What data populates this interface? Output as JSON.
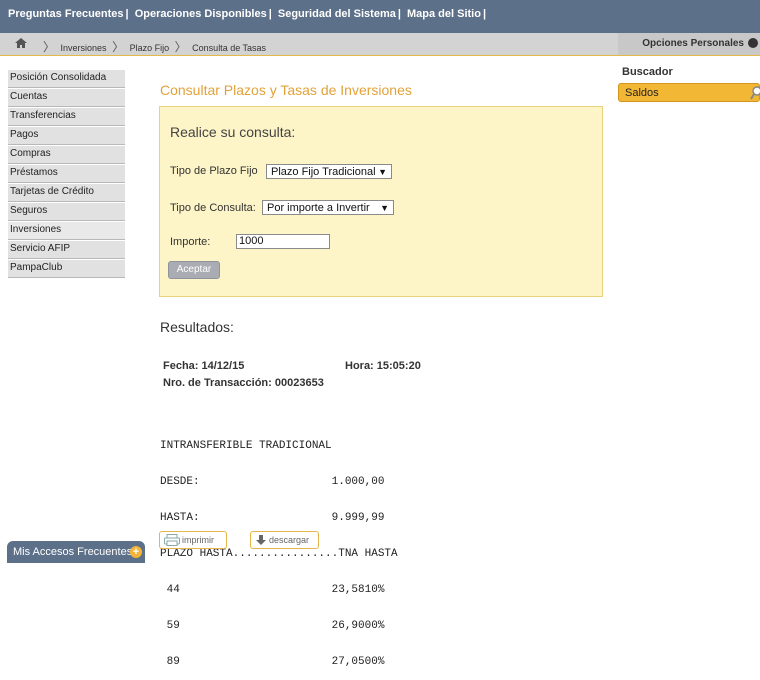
{
  "topnav": {
    "items": [
      "Preguntas Frecuentes",
      "Operaciones Disponibles",
      "Seguridad del Sistema",
      "Mapa del Sitio"
    ],
    "separator": "|"
  },
  "breadcrumb": {
    "items": [
      "Inversiones",
      "Plazo Fijo",
      "Consulta de Tasas"
    ],
    "home_icon": "home-icon"
  },
  "personal": {
    "label": "Opciones Personales"
  },
  "sidebar": {
    "items": [
      {
        "label": "Posición Consolidada"
      },
      {
        "label": "Cuentas"
      },
      {
        "label": "Transferencias"
      },
      {
        "label": "Pagos"
      },
      {
        "label": "Compras"
      },
      {
        "label": "Préstamos"
      },
      {
        "label": "Tarjetas de Crédito"
      },
      {
        "label": "Seguros"
      },
      {
        "label": "Inversiones"
      },
      {
        "label": "Servicio AFIP"
      },
      {
        "label": "PampaClub"
      }
    ]
  },
  "access": {
    "label": "Mis Accesos Frecuentes"
  },
  "search": {
    "title": "Buscador",
    "value": "Saldos"
  },
  "main": {
    "title": "Consultar Plazos y Tasas de Inversiones",
    "form": {
      "heading": "Realice su consulta:",
      "tipo_plazo_label": "Tipo de Plazo Fijo",
      "tipo_plazo_value": "Plazo Fijo Tradicional",
      "tipo_consulta_label": "Tipo de Consulta:",
      "tipo_consulta_value": "Por importe a Invertir",
      "importe_label": "Importe:",
      "importe_value": "1000",
      "submit_label": "Aceptar"
    },
    "results": {
      "heading": "Resultados:",
      "fecha": "Fecha: 14/12/15",
      "hora": "Hora: 15:05:20",
      "transaccion": "Nro. de Transacción: 00023653",
      "lines": [
        "INTRANSFERIBLE TRADICIONAL",
        "DESDE:                    1.000,00",
        "HASTA:                    9.999,99",
        "PLAZO HASTA................TNA HASTA",
        " 44                       23,5810%",
        " 59                       26,9000%",
        " 89                       27,0500%"
      ]
    },
    "actions": {
      "print_label": "imprimir",
      "download_label": "descargar"
    }
  },
  "colors": {
    "nav": "#5d7089",
    "accent": "#e2a23a",
    "panel": "#fdf4c7",
    "search": "#f3b736"
  }
}
